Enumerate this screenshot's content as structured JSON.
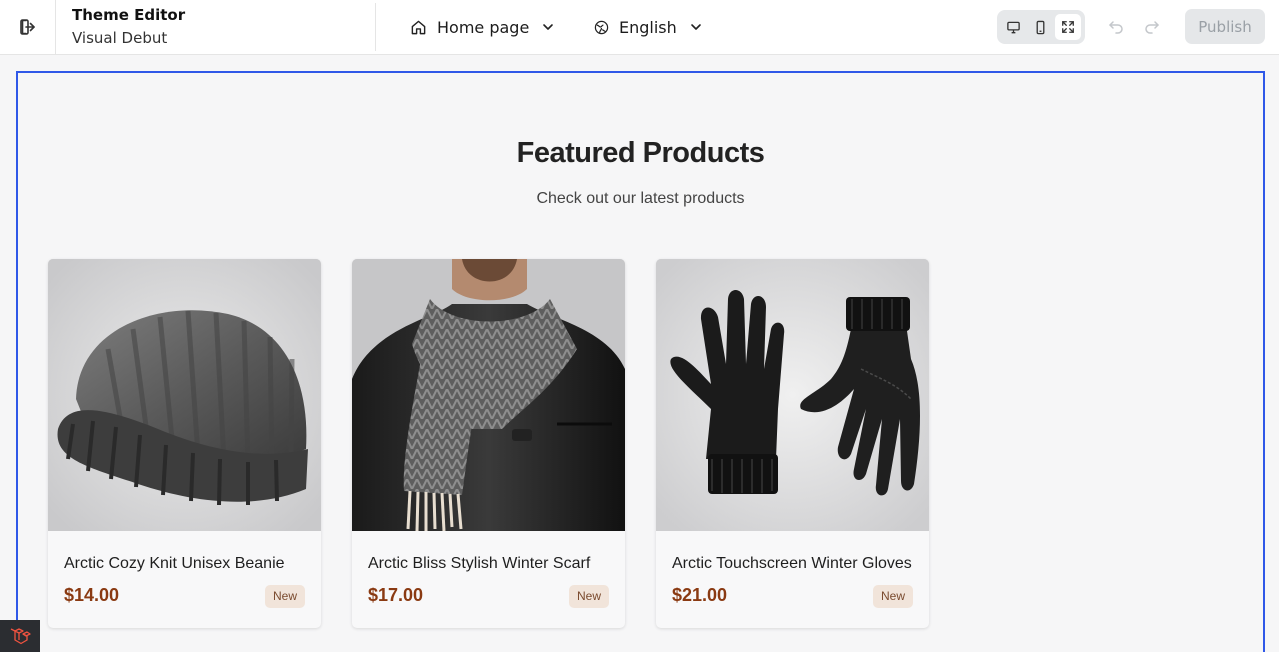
{
  "app": {
    "title": "Theme Editor",
    "theme_name": "Visual Debut"
  },
  "toolbar": {
    "page_selector": {
      "label": "Home page",
      "icon": "home-icon"
    },
    "language_selector": {
      "label": "English",
      "icon": "globe-icon"
    },
    "device_modes": [
      {
        "name": "desktop",
        "icon": "desktop-icon",
        "active": false
      },
      {
        "name": "mobile",
        "icon": "mobile-icon",
        "active": false
      },
      {
        "name": "fullscreen",
        "icon": "fullscreen-icon",
        "active": true
      }
    ],
    "publish_label": "Publish"
  },
  "section": {
    "title": "Featured Products",
    "subtitle": "Check out our latest products"
  },
  "products": [
    {
      "name": "Arctic Cozy Knit Unisex Beanie",
      "price": "$14.00",
      "badge": "New",
      "image": "beanie"
    },
    {
      "name": "Arctic Bliss Stylish Winter Scarf",
      "price": "$17.00",
      "badge": "New",
      "image": "scarf"
    },
    {
      "name": "Arctic Touchscreen Winter Gloves",
      "price": "$21.00",
      "badge": "New",
      "image": "gloves"
    }
  ],
  "colors": {
    "frame_outline": "#2f58e8",
    "price": "#8a3a12",
    "badge_bg": "#f1e4da",
    "publish_disabled_bg": "#e5e7e9"
  }
}
